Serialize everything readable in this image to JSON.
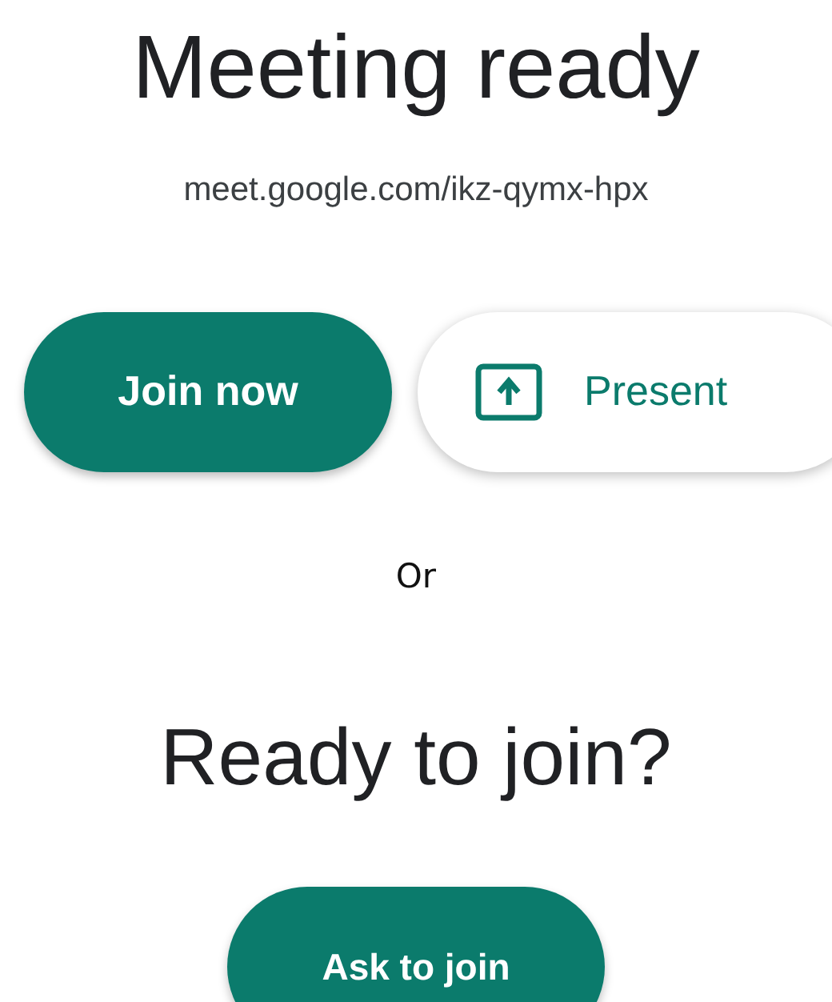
{
  "title": "Meeting ready",
  "meeting_link": "meet.google.com/ikz-qymx-hpx",
  "actions": [
    {
      "label": "Join now",
      "kind": "filled"
    },
    {
      "label": "Present",
      "kind": "present"
    }
  ],
  "separator": "Or",
  "join_heading": "Ready to join?",
  "ask_button": {
    "label": "Ask to join"
  }
}
